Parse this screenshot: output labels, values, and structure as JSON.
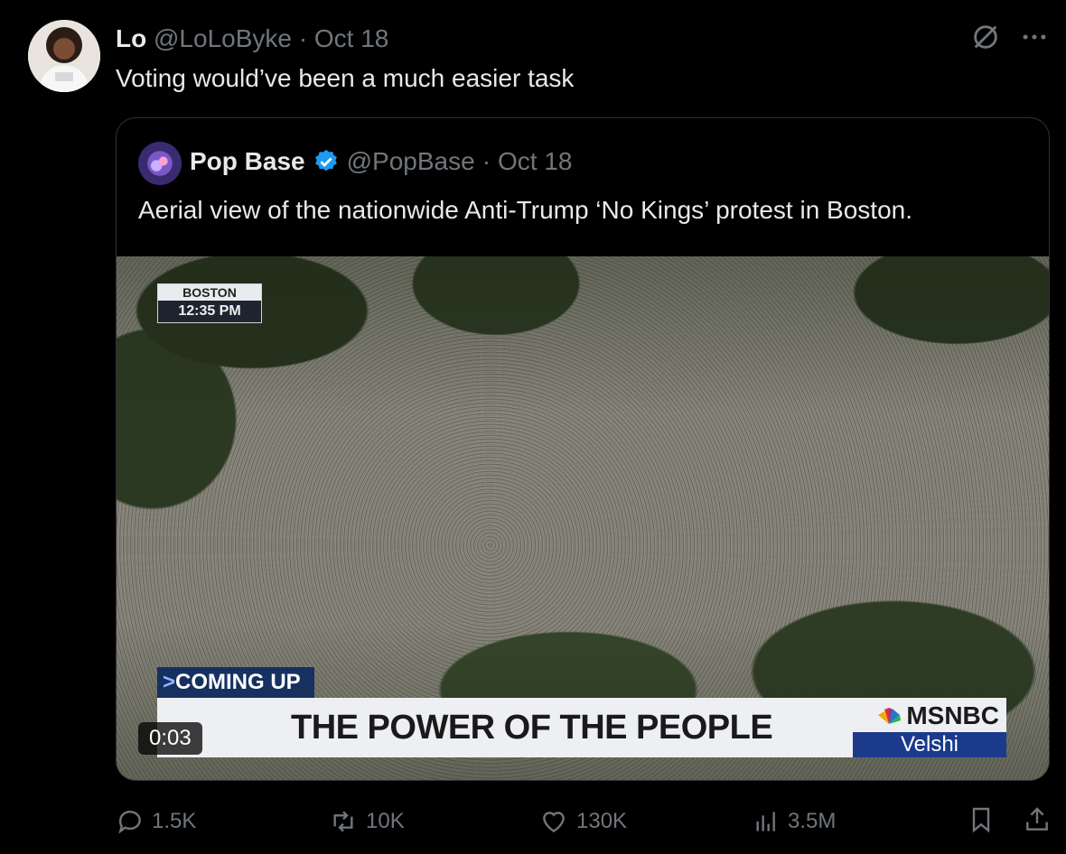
{
  "tweet": {
    "author_name": "Lo",
    "author_handle": "@LoLoByke",
    "separator": "·",
    "date": "Oct 18",
    "text": "Voting would’ve been a much easier task"
  },
  "quoted_tweet": {
    "author_name": "Pop Base",
    "author_handle": "@PopBase",
    "separator": "·",
    "date": "Oct 18",
    "text": "Aerial view of the nationwide Anti-Trump ‘No Kings’ protest in Boston.",
    "video": {
      "location": "BOSTON",
      "time_shown": "12:35 PM",
      "coming_up": "COMING UP",
      "headline": "THE POWER OF THE PEOPLE",
      "network": "MSNBC",
      "show": "Velshi",
      "timer": "0:03"
    }
  },
  "actions": {
    "replies": "1.5K",
    "reposts": "10K",
    "likes": "130K",
    "views": "3.5M"
  },
  "colors": {
    "background": "#000000",
    "text": "#e7e9ea",
    "muted": "#71767b",
    "border": "#2f3336",
    "verified": "#1d9bf0"
  },
  "icons": [
    "grok-icon",
    "more-icon",
    "verified-icon",
    "reply-icon",
    "repost-icon",
    "like-icon",
    "views-icon",
    "bookmark-icon",
    "share-icon"
  ]
}
